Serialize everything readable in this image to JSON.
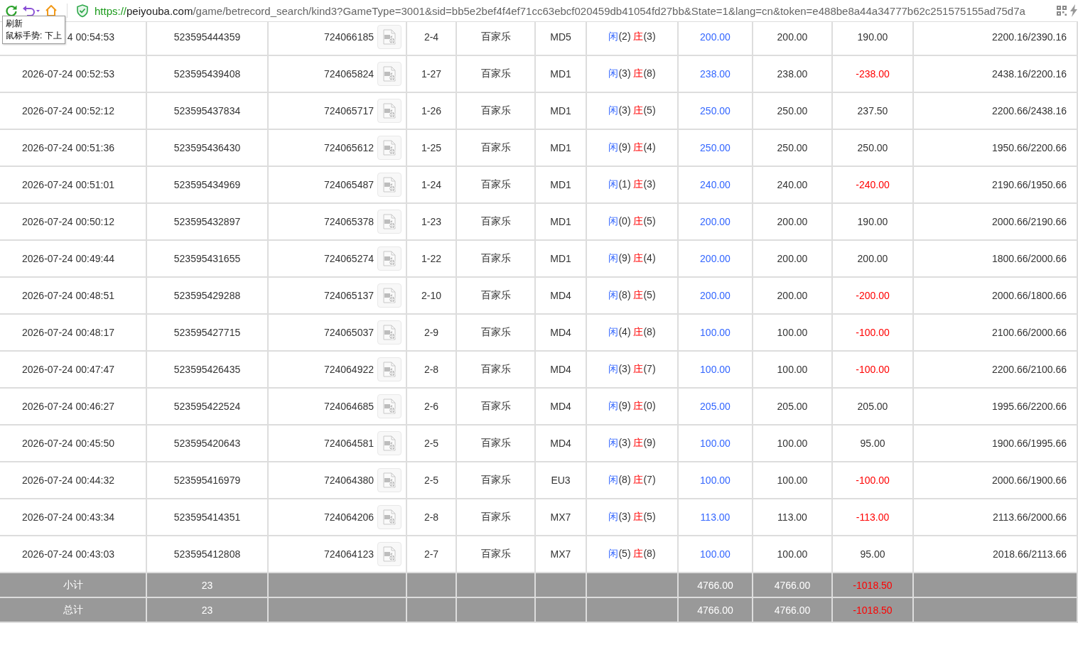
{
  "toolbar": {
    "url": {
      "scheme": "https://",
      "host": "peiyouba.com",
      "path": "/game/betrecord_search/kind3?GameType=3001&sid=bb5e2bef4f4ef71cc63ebcf020459db41054fd27bb&State=1&lang=cn&token=e488be8a44a34777b62c251575155ad75d7a"
    }
  },
  "tooltip": {
    "title": "刷新",
    "hint": "鼠标手势: 下上"
  },
  "table": {
    "rows": [
      {
        "column_1": "4 00:54:53",
        "column_2": "523595444359",
        "column_3": "724066185",
        "column_4": "2-4",
        "column_5": "百家乐",
        "column_6": "MD5",
        "column_7": {
          "player_label": "闲",
          "player": "(2)",
          "banker_label": "庄",
          "banker": "(3)"
        },
        "column_8": "200.00",
        "column_9": "200.00",
        "column_10": "190.00",
        "loss": false,
        "column_11": "2200.16/2390.16"
      },
      {
        "column_1": "2026-07-24 00:52:53",
        "column_2": "523595439408",
        "column_3": "724065824",
        "column_4": "1-27",
        "column_5": "百家乐",
        "column_6": "MD1",
        "column_7": {
          "player_label": "闲",
          "player": "(3)",
          "banker_label": "庄",
          "banker": "(8)"
        },
        "column_8": "238.00",
        "column_9": "238.00",
        "column_10": "-238.00",
        "loss": true,
        "column_11": "2438.16/2200.16"
      },
      {
        "column_1": "2026-07-24 00:52:12",
        "column_2": "523595437834",
        "column_3": "724065717",
        "column_4": "1-26",
        "column_5": "百家乐",
        "column_6": "MD1",
        "column_7": {
          "player_label": "闲",
          "player": "(3)",
          "banker_label": "庄",
          "banker": "(5)"
        },
        "column_8": "250.00",
        "column_9": "250.00",
        "column_10": "237.50",
        "loss": false,
        "column_11": "2200.66/2438.16"
      },
      {
        "column_1": "2026-07-24 00:51:36",
        "column_2": "523595436430",
        "column_3": "724065612",
        "column_4": "1-25",
        "column_5": "百家乐",
        "column_6": "MD1",
        "column_7": {
          "player_label": "闲",
          "player": "(9)",
          "banker_label": "庄",
          "banker": "(4)"
        },
        "column_8": "250.00",
        "column_9": "250.00",
        "column_10": "250.00",
        "loss": false,
        "column_11": "1950.66/2200.66"
      },
      {
        "column_1": "2026-07-24 00:51:01",
        "column_2": "523595434969",
        "column_3": "724065487",
        "column_4": "1-24",
        "column_5": "百家乐",
        "column_6": "MD1",
        "column_7": {
          "player_label": "闲",
          "player": "(1)",
          "banker_label": "庄",
          "banker": "(3)"
        },
        "column_8": "240.00",
        "column_9": "240.00",
        "column_10": "-240.00",
        "loss": true,
        "column_11": "2190.66/1950.66"
      },
      {
        "column_1": "2026-07-24 00:50:12",
        "column_2": "523595432897",
        "column_3": "724065378",
        "column_4": "1-23",
        "column_5": "百家乐",
        "column_6": "MD1",
        "column_7": {
          "player_label": "闲",
          "player": "(0)",
          "banker_label": "庄",
          "banker": "(5)"
        },
        "column_8": "200.00",
        "column_9": "200.00",
        "column_10": "190.00",
        "loss": false,
        "column_11": "2000.66/2190.66"
      },
      {
        "column_1": "2026-07-24 00:49:44",
        "column_2": "523595431655",
        "column_3": "724065274",
        "column_4": "1-22",
        "column_5": "百家乐",
        "column_6": "MD1",
        "column_7": {
          "player_label": "闲",
          "player": "(9)",
          "banker_label": "庄",
          "banker": "(4)"
        },
        "column_8": "200.00",
        "column_9": "200.00",
        "column_10": "200.00",
        "loss": false,
        "column_11": "1800.66/2000.66"
      },
      {
        "column_1": "2026-07-24 00:48:51",
        "column_2": "523595429288",
        "column_3": "724065137",
        "column_4": "2-10",
        "column_5": "百家乐",
        "column_6": "MD4",
        "column_7": {
          "player_label": "闲",
          "player": "(8)",
          "banker_label": "庄",
          "banker": "(5)"
        },
        "column_8": "200.00",
        "column_9": "200.00",
        "column_10": "-200.00",
        "loss": true,
        "column_11": "2000.66/1800.66"
      },
      {
        "column_1": "2026-07-24 00:48:17",
        "column_2": "523595427715",
        "column_3": "724065037",
        "column_4": "2-9",
        "column_5": "百家乐",
        "column_6": "MD4",
        "column_7": {
          "player_label": "闲",
          "player": "(4)",
          "banker_label": "庄",
          "banker": "(8)"
        },
        "column_8": "100.00",
        "column_9": "100.00",
        "column_10": "-100.00",
        "loss": true,
        "column_11": "2100.66/2000.66"
      },
      {
        "column_1": "2026-07-24 00:47:47",
        "column_2": "523595426435",
        "column_3": "724064922",
        "column_4": "2-8",
        "column_5": "百家乐",
        "column_6": "MD4",
        "column_7": {
          "player_label": "闲",
          "player": "(3)",
          "banker_label": "庄",
          "banker": "(7)"
        },
        "column_8": "100.00",
        "column_9": "100.00",
        "column_10": "-100.00",
        "loss": true,
        "column_11": "2200.66/2100.66"
      },
      {
        "column_1": "2026-07-24 00:46:27",
        "column_2": "523595422524",
        "column_3": "724064685",
        "column_4": "2-6",
        "column_5": "百家乐",
        "column_6": "MD4",
        "column_7": {
          "player_label": "闲",
          "player": "(9)",
          "banker_label": "庄",
          "banker": "(0)"
        },
        "column_8": "205.00",
        "column_9": "205.00",
        "column_10": "205.00",
        "loss": false,
        "column_11": "1995.66/2200.66"
      },
      {
        "column_1": "2026-07-24 00:45:50",
        "column_2": "523595420643",
        "column_3": "724064581",
        "column_4": "2-5",
        "column_5": "百家乐",
        "column_6": "MD4",
        "column_7": {
          "player_label": "闲",
          "player": "(3)",
          "banker_label": "庄",
          "banker": "(9)"
        },
        "column_8": "100.00",
        "column_9": "100.00",
        "column_10": "95.00",
        "loss": false,
        "column_11": "1900.66/1995.66"
      },
      {
        "column_1": "2026-07-24 00:44:32",
        "column_2": "523595416979",
        "column_3": "724064380",
        "column_4": "2-5",
        "column_5": "百家乐",
        "column_6": "EU3",
        "column_7": {
          "player_label": "闲",
          "player": "(8)",
          "banker_label": "庄",
          "banker": "(7)"
        },
        "column_8": "100.00",
        "column_9": "100.00",
        "column_10": "-100.00",
        "loss": true,
        "column_11": "2000.66/1900.66"
      },
      {
        "column_1": "2026-07-24 00:43:34",
        "column_2": "523595414351",
        "column_3": "724064206",
        "column_4": "2-8",
        "column_5": "百家乐",
        "column_6": "MX7",
        "column_7": {
          "player_label": "闲",
          "player": "(3)",
          "banker_label": "庄",
          "banker": "(5)"
        },
        "column_8": "113.00",
        "column_9": "113.00",
        "column_10": "-113.00",
        "loss": true,
        "column_11": "2113.66/2000.66"
      },
      {
        "column_1": "2026-07-24 00:43:03",
        "column_2": "523595412808",
        "column_3": "724064123",
        "column_4": "2-7",
        "column_5": "百家乐",
        "column_6": "MX7",
        "column_7": {
          "player_label": "闲",
          "player": "(5)",
          "banker_label": "庄",
          "banker": "(8)"
        },
        "column_8": "100.00",
        "column_9": "100.00",
        "column_10": "95.00",
        "loss": false,
        "column_11": "2018.66/2113.66"
      }
    ],
    "totals": [
      {
        "label": "小计",
        "count": "23",
        "column_8": "4766.00",
        "column_9": "4766.00",
        "column_10": "-1018.50",
        "loss": true
      },
      {
        "label": "总计",
        "count": "23",
        "column_8": "4766.00",
        "column_9": "4766.00",
        "column_10": "-1018.50",
        "loss": true
      }
    ]
  }
}
